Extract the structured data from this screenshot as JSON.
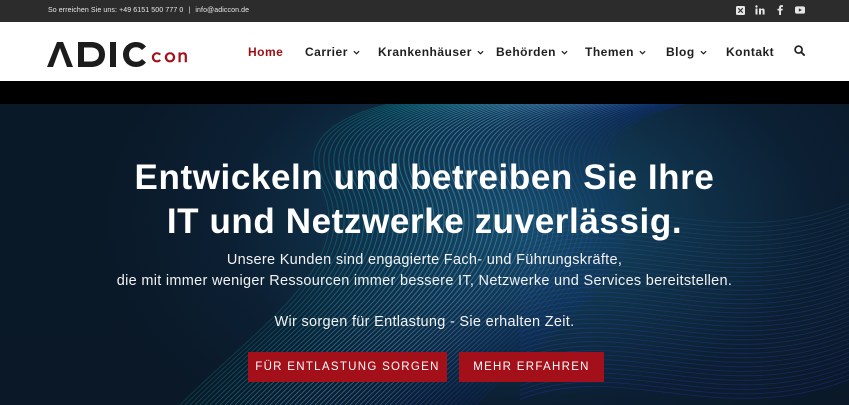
{
  "topbar": {
    "phone_text": "So erreichen Sie uns: +49 6151 500 777 0",
    "separator": "|",
    "email": "info@adiccon.de",
    "socials": [
      "x-icon",
      "linkedin-icon",
      "facebook-icon",
      "youtube-icon"
    ]
  },
  "header": {
    "logo_text": "ADICCON",
    "nav": [
      {
        "label": "Home",
        "active": true,
        "dropdown": false
      },
      {
        "label": "Carrier",
        "active": false,
        "dropdown": true
      },
      {
        "label": "Krankenhäuser",
        "active": false,
        "dropdown": true
      },
      {
        "label": "Behörden",
        "active": false,
        "dropdown": true
      },
      {
        "label": "Themen",
        "active": false,
        "dropdown": true
      },
      {
        "label": "Blog",
        "active": false,
        "dropdown": true
      },
      {
        "label": "Kontakt",
        "active": false,
        "dropdown": false
      }
    ],
    "search_icon": "search-icon"
  },
  "hero": {
    "headline_line1": "Entwickeln und betreiben Sie Ihre",
    "headline_line2": "IT und Netzwerke zuverlässig.",
    "sub_line1": "Unsere Kunden sind engagierte Fach- und Führungskräfte,",
    "sub_line2": "die mit immer weniger Ressourcen immer bessere IT, Netzwerke und Services bereitstellen.",
    "sub_line3": "Wir sorgen für Entlastung - Sie erhalten Zeit.",
    "button_primary": "FÜR ENTLASTUNG SORGEN",
    "button_secondary": "MEHR ERFAHREN"
  },
  "colors": {
    "accent": "#a3101a",
    "active_nav": "#9d0d14",
    "topbar_bg": "#2c2c2c",
    "hero_bg": "#0c2238"
  }
}
